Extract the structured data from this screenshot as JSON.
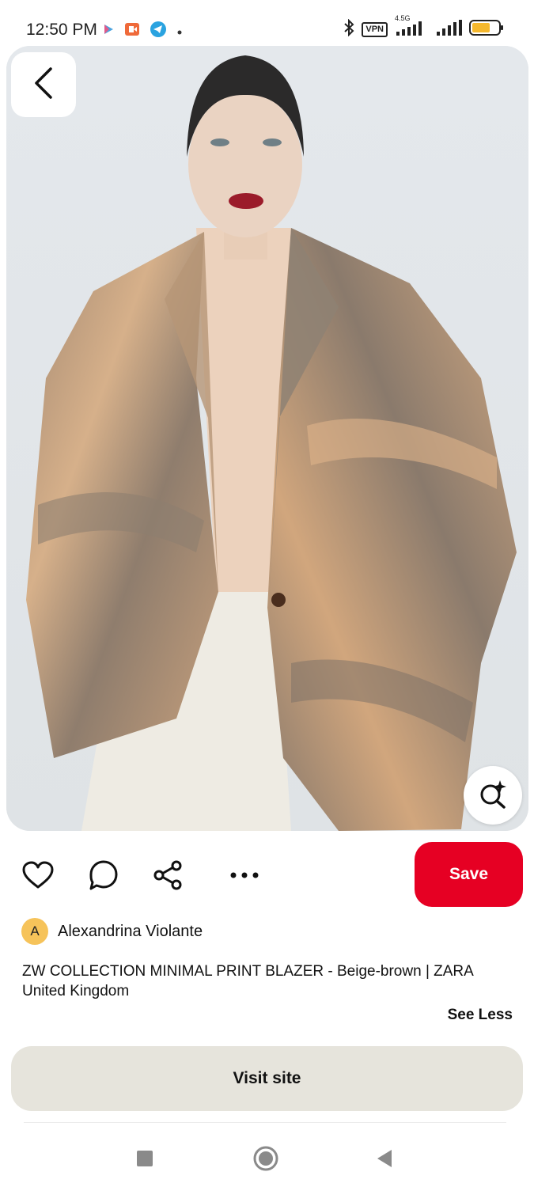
{
  "status_bar": {
    "time": "12:50 PM",
    "left_icons": [
      "play-store-icon",
      "recorder-icon",
      "telegram-icon",
      "dot-icon"
    ],
    "vpn": "VPN",
    "network": "4.5G",
    "right_icons": [
      "bluetooth-icon",
      "vpn-icon",
      "signal-icon",
      "signal-icon",
      "battery-icon"
    ],
    "battery_color": "#f5b82e"
  },
  "pin": {
    "image_icon": "product-photo",
    "back_icon": "chevron-left-icon",
    "lens_icon": "visual-search-icon"
  },
  "actions": {
    "icons": [
      "heart-icon",
      "comment-icon",
      "share-icon",
      "more-icon"
    ],
    "save_label": "Save",
    "save_color": "#e60023"
  },
  "creator": {
    "initial": "A",
    "name": "Alexandrina Violante",
    "avatar_color": "#f6c35a"
  },
  "description": {
    "title": "ZW COLLECTION MINIMAL PRINT BLAZER - Beige-brown | ZARA United Kingdom",
    "toggle_label": "See Less"
  },
  "visit": {
    "label": "Visit site",
    "background": "#e6e4dc"
  },
  "nav_bar": {
    "icons": [
      "recents-square-icon",
      "home-circle-icon",
      "back-triangle-icon"
    ]
  }
}
